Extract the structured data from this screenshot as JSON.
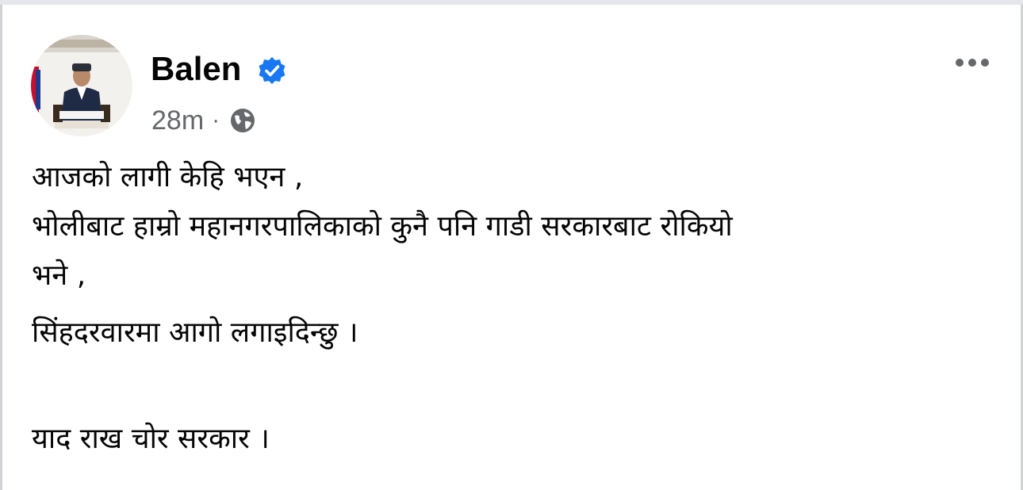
{
  "post": {
    "author": {
      "name": "Balen",
      "verified": true,
      "verified_color": "#1877f2"
    },
    "meta": {
      "time": "28m",
      "separator": "·",
      "audience_icon": "globe-icon"
    },
    "more_icon": "more-horizontal-icon",
    "lines": [
      "आजको लागी केहि भएन ,",
      "भोलीबाट हाम्रो महानगरपालिकाको कुनै पनि गाडी सरकारबाट रोकियो",
      "भने ,",
      "सिंहदरवारमा आगो लगाइदिन्छु ।",
      "याद राख चोर सरकार ।"
    ]
  },
  "colors": {
    "text": "#050505",
    "secondary_text": "#65676b",
    "verified_badge": "#1877f2",
    "frame": "#e4e6eb"
  }
}
